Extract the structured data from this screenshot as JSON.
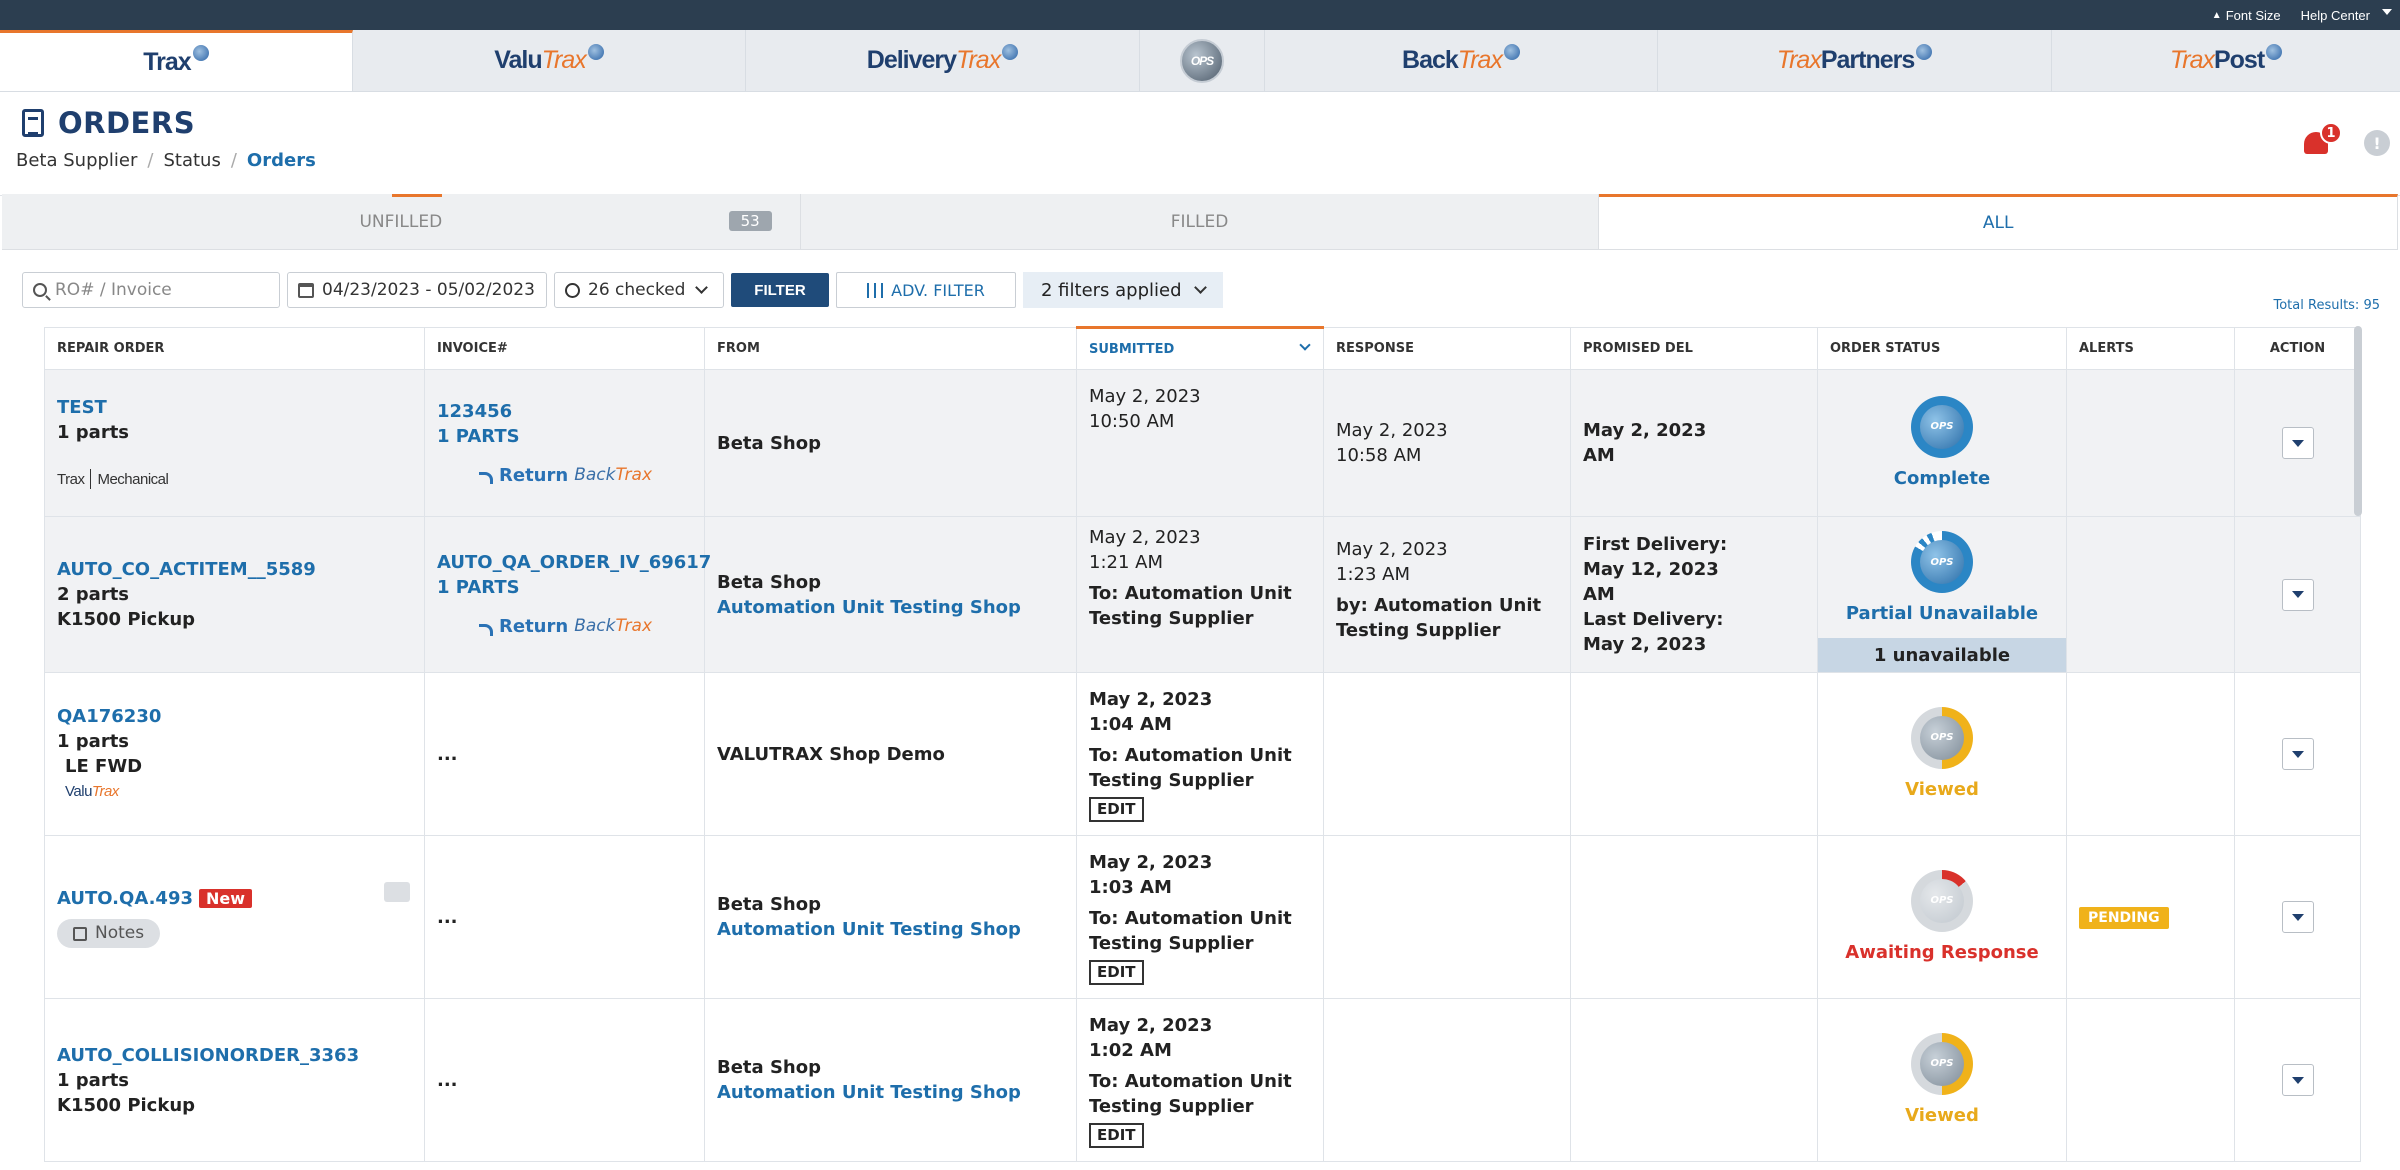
{
  "topbar": {
    "font_size": "Font Size",
    "help_center": "Help Center"
  },
  "apptabs": [
    {
      "name": "trax",
      "bold": "",
      "orange": "Trax"
    },
    {
      "name": "valutrax",
      "bold": "Valu",
      "orange": "Trax"
    },
    {
      "name": "deliverytrax",
      "bold": "Delivery",
      "orange": "Trax"
    },
    {
      "name": "ops",
      "bold": "",
      "orange": ""
    },
    {
      "name": "backtrax",
      "bold": "Back",
      "orange": "Trax"
    },
    {
      "name": "traxpartners",
      "bold": "Partners",
      "orange": "Trax"
    },
    {
      "name": "traxpost",
      "bold": "Post",
      "orange": "Trax"
    }
  ],
  "ops_label": "OPS",
  "page": {
    "title": "ORDERS",
    "breadcrumb": [
      "Beta Supplier",
      "Status",
      "Orders"
    ],
    "notifications": "1",
    "chat_icon": "!"
  },
  "status_tabs": {
    "unfilled": "UNFILLED",
    "unfilled_count": "53",
    "filled": "FILLED",
    "all": "ALL"
  },
  "filters": {
    "search_placeholder": "RO# / Invoice",
    "date_range": "04/23/2023 - 05/02/2023",
    "checked": "26 checked",
    "filter_btn": "FILTER",
    "adv_filter_btn": "ADV. FILTER",
    "applied": "2 filters applied",
    "total_results": "Total Results: 95"
  },
  "columns": {
    "repair_order": "REPAIR ORDER",
    "invoice": "INVOICE#",
    "from": "FROM",
    "submitted": "SUBMITTED",
    "response": "RESPONSE",
    "promised": "PROMISED DEL",
    "order_status": "ORDER STATUS",
    "alerts": "ALERTS",
    "action": "ACTION"
  },
  "rows": [
    {
      "ro": "TEST",
      "parts": "1 parts",
      "logo_trax": "Trax",
      "logo_mech": "Mechanical",
      "invoice": "123456",
      "invoice_parts": "1 PARTS",
      "return": "Return",
      "return_back": "Back",
      "return_trax": "Trax",
      "from": "Beta Shop",
      "submitted_date": "May 2, 2023",
      "submitted_time": "10:50 AM",
      "response_date": "May 2, 2023",
      "response_time": "10:58 AM",
      "promised_1": "May 2, 2023",
      "promised_2": "AM",
      "status": "Complete"
    },
    {
      "ro": "AUTO_CO_ACTITEM__5589",
      "parts": "2 parts",
      "vehicle": "K1500 Pickup",
      "invoice": "AUTO_QA_ORDER_IV_69617",
      "invoice_parts": "1 PARTS",
      "return": "Return",
      "return_back": "Back",
      "return_trax": "Trax",
      "from": "Beta Shop",
      "from_sub": "Automation Unit Testing Shop",
      "submitted_date": "May 2, 2023",
      "submitted_time": "1:21 AM",
      "submitted_to": "To: Automation Unit Testing Supplier",
      "response_date": "May 2, 2023",
      "response_time": "1:23 AM",
      "response_by": "by: Automation Unit Testing Supplier",
      "promised_first_label": "First Delivery:",
      "promised_first": "May 12, 2023",
      "promised_first_am": "AM",
      "promised_last_label": "Last Delivery:",
      "promised_last": "May 2, 2023",
      "status": "Partial Unavailable",
      "unavailable": "1 unavailable"
    },
    {
      "ro": "QA176230",
      "parts": "1 parts",
      "vehicle": "LE FWD",
      "logo_valu": "Valu",
      "logo_trax": "Trax",
      "invoice": "...",
      "from": "VALUTRAX Shop Demo",
      "submitted_date": "May 2, 2023",
      "submitted_time": "1:04 AM",
      "submitted_to": "To: Automation Unit Testing Supplier",
      "edit": "EDIT",
      "status": "Viewed"
    },
    {
      "ro": "AUTO.QA.493",
      "new": "New",
      "notes": "Notes",
      "invoice": "...",
      "from": "Beta Shop",
      "from_sub": "Automation Unit Testing Shop",
      "submitted_date": "May 2, 2023",
      "submitted_time": "1:03 AM",
      "submitted_to": "To: Automation Unit Testing Supplier",
      "edit": "EDIT",
      "status": "Awaiting Response",
      "alert": "PENDING"
    },
    {
      "ro": "AUTO_COLLISIONORDER_3363",
      "parts": "1 parts",
      "vehicle": "K1500 Pickup",
      "invoice": "...",
      "from": "Beta Shop",
      "from_sub": "Automation Unit Testing Shop",
      "submitted_date": "May 2, 2023",
      "submitted_time": "1:02 AM",
      "submitted_to": "To: Automation Unit Testing Supplier",
      "edit": "EDIT",
      "status": "Viewed"
    }
  ]
}
